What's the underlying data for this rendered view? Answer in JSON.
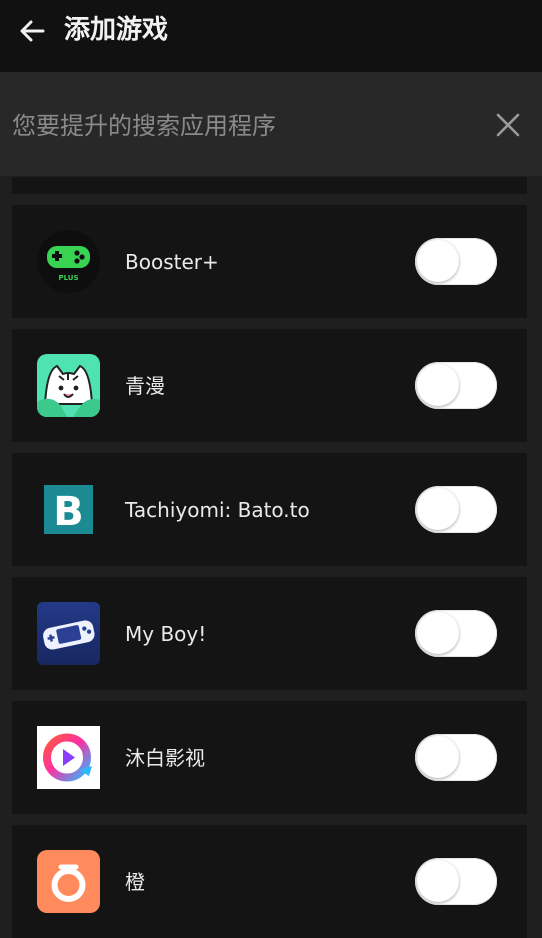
{
  "header": {
    "title": "添加游戏",
    "back_icon": "arrow-left-icon"
  },
  "search": {
    "placeholder": "您要提升的搜索应用程序",
    "clear_icon": "close-icon"
  },
  "apps": [
    {
      "name": "Booster+",
      "icon": "gamepad-plus-icon",
      "enabled": false
    },
    {
      "name": "青漫",
      "icon": "cat-comic-icon",
      "enabled": false
    },
    {
      "name": "Tachiyomi: Bato.to",
      "icon": "letter-b-icon",
      "enabled": false
    },
    {
      "name": "My Boy!",
      "icon": "handheld-console-icon",
      "enabled": false
    },
    {
      "name": "沐白影视",
      "icon": "play-ring-icon",
      "enabled": false
    },
    {
      "name": "橙",
      "icon": "orange-ring-icon",
      "enabled": false
    }
  ],
  "colors": {
    "background": "#1f1f1f",
    "topbar": "#111111",
    "searchbar": "#282828",
    "row": "#141414",
    "booster_green": "#39d353",
    "tachiyomi_teal": "#1b8a93",
    "orange": "#ff8a5c"
  }
}
